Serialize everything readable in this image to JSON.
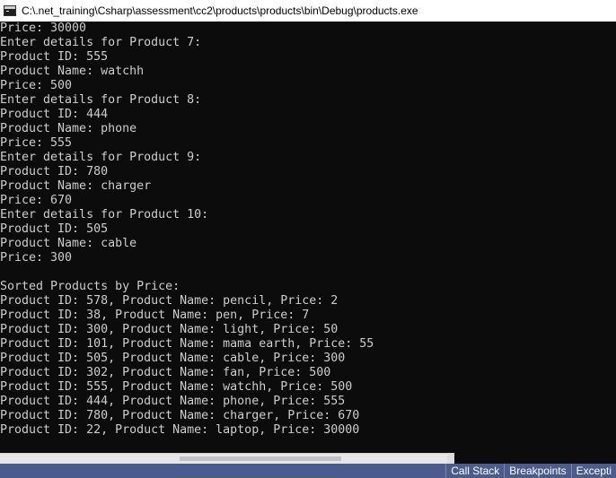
{
  "window": {
    "title": "C:\\.net_training\\Csharp\\assessment\\cc2\\products\\products\\bin\\Debug\\products.exe"
  },
  "console": {
    "lines": [
      "Price: 30000",
      "Enter details for Product 7:",
      "Product ID: 555",
      "Product Name: watchh",
      "Price: 500",
      "Enter details for Product 8:",
      "Product ID: 444",
      "Product Name: phone",
      "Price: 555",
      "Enter details for Product 9:",
      "Product ID: 780",
      "Product Name: charger",
      "Price: 670",
      "Enter details for Product 10:",
      "Product ID: 505",
      "Product Name: cable",
      "Price: 300",
      "",
      "Sorted Products by Price:",
      "Product ID: 578, Product Name: pencil, Price: 2",
      "Product ID: 38, Product Name: pen, Price: 7",
      "Product ID: 300, Product Name: light, Price: 50",
      "Product ID: 101, Product Name: mama earth, Price: 55",
      "Product ID: 505, Product Name: cable, Price: 300",
      "Product ID: 302, Product Name: fan, Price: 500",
      "Product ID: 555, Product Name: watchh, Price: 500",
      "Product ID: 444, Product Name: phone, Price: 555",
      "Product ID: 780, Product Name: charger, Price: 670",
      "Product ID: 22, Product Name: laptop, Price: 30000"
    ]
  },
  "vs_toolbar": {
    "tabs": [
      "Call Stack",
      "Breakpoints",
      "Excepti"
    ]
  },
  "colors": {
    "console_bg": "#0c0c0c",
    "console_text": "#cccccc",
    "vs_bar": "#4b5c8c"
  }
}
